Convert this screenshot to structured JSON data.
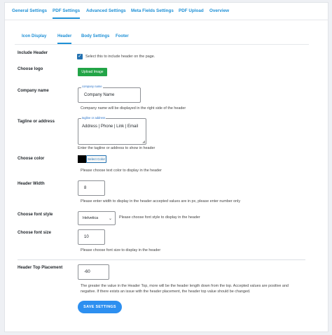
{
  "top_tabs": [
    {
      "label": "General Settings"
    },
    {
      "label": "PDF Settings"
    },
    {
      "label": "Advanced Settings"
    },
    {
      "label": "Meta Fields Settings"
    },
    {
      "label": "PDF Upload"
    },
    {
      "label": "Overview"
    }
  ],
  "active_top_tab": "PDF Settings",
  "sub_tabs": [
    {
      "label": "Icon Display"
    },
    {
      "label": "Header"
    },
    {
      "label": "Body Settings"
    },
    {
      "label": "Footer"
    }
  ],
  "active_sub_tab": "Header",
  "form": {
    "include_header": {
      "label": "Include Header",
      "description": "Select this to include header on the page.",
      "checked": true
    },
    "choose_logo": {
      "label": "Choose logo",
      "button": "Upload Image"
    },
    "company_name": {
      "label": "Company name",
      "floating_label": "company name",
      "value": "Company Name",
      "description": "Company name will be displayed in the right side of the header"
    },
    "tagline": {
      "label": "Tagline or address",
      "floating_label": "tagline or address",
      "value": "Address | Phone | Link | Email",
      "description": "Enter the tagline or address to show in header"
    },
    "choose_color": {
      "label": "Choose color",
      "swatch_color": "#000000",
      "button": "Select Color",
      "description": "Please choose text color to display in the header"
    },
    "header_width": {
      "label": "Header Width",
      "value": "8",
      "description": "Please enter width to display in the header accepted values are in px, please enter number only"
    },
    "font_style": {
      "label": "Choose font style",
      "value": "Helvetica",
      "description": "Please choose font style to display in the header"
    },
    "font_size": {
      "label": "Choose font size",
      "value": "10",
      "description": "Please choose font size to display in the header"
    },
    "header_top": {
      "label": "Header Top Placement",
      "value": "-60",
      "description": "The greater the value in the Header Top, more will be the header length down from the top. Accepted values are positive and negative. If there exists an issue with the header placement, the header top value should be changed."
    }
  },
  "save_button": "SAVE SETTINGS",
  "colors": {
    "accent": "#1e90d6",
    "primary_button": "#2d8ff0",
    "upload_button": "#22a447"
  }
}
